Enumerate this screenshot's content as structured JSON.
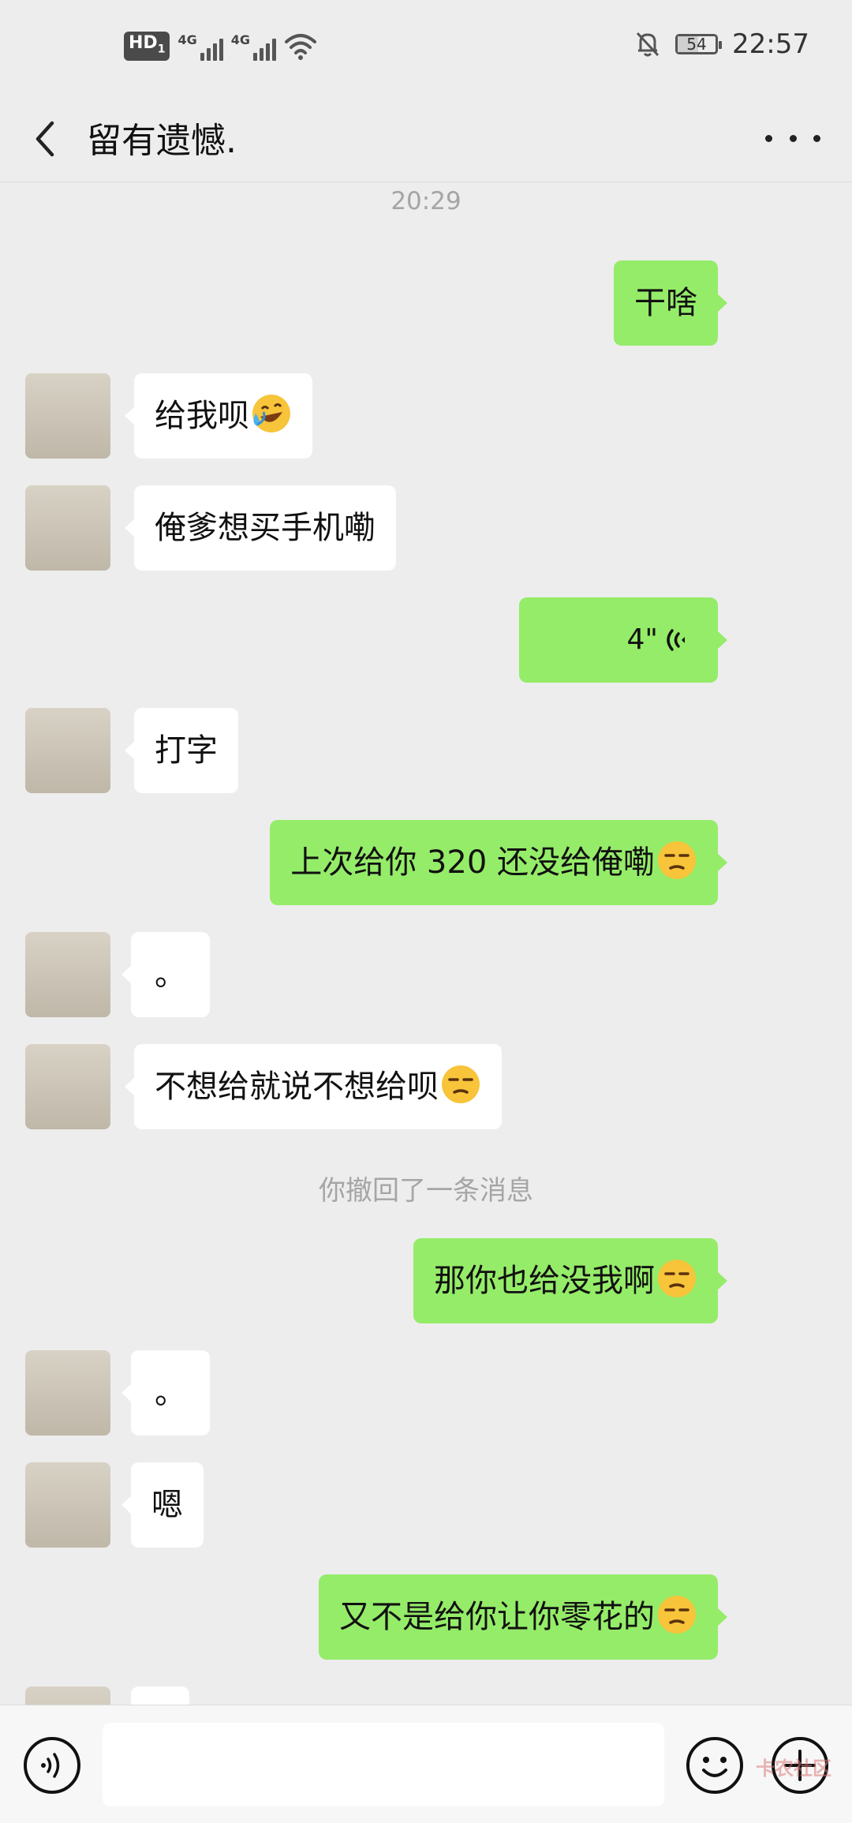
{
  "status_bar": {
    "hd_label": "HD",
    "hd_sub": "1",
    "sim1_tag": "4G",
    "sim2_tag": "4G",
    "battery_level": "54",
    "battery_fraction": 0.54,
    "time": "22:57"
  },
  "header": {
    "title": "留有遗憾.",
    "back_icon": "chevron-left-icon",
    "more_icon": "more-dots-icon"
  },
  "messages": {
    "timestamp": "20:29",
    "m1": {
      "text": "干啥"
    },
    "m2": {
      "text": "给我呗"
    },
    "m3": {
      "text": "俺爹想买手机嘞"
    },
    "m4": {
      "duration": "4\""
    },
    "m5": {
      "text": "打字"
    },
    "m6": {
      "text": "上次给你 320 还没给俺嘞"
    },
    "m7": {
      "text": "。"
    },
    "m8": {
      "text": "不想给就说不想给呗"
    },
    "recall_notice": "你撤回了一条消息",
    "m9": {
      "text": "那你也给没我啊"
    },
    "m10": {
      "text": "。"
    },
    "m11": {
      "text": "嗯"
    },
    "m12": {
      "text": "又不是给你让你零花的"
    }
  },
  "input_bar": {
    "voice_icon": "voice-mode-icon",
    "emoji_icon": "emoji-icon",
    "plus_icon": "plus-icon",
    "input_value": "",
    "watermark": "卡农社区"
  },
  "colors": {
    "background": "#ededed",
    "outgoing_bubble": "#95ec69",
    "incoming_bubble": "#ffffff",
    "system_text": "#a5a5a5"
  }
}
